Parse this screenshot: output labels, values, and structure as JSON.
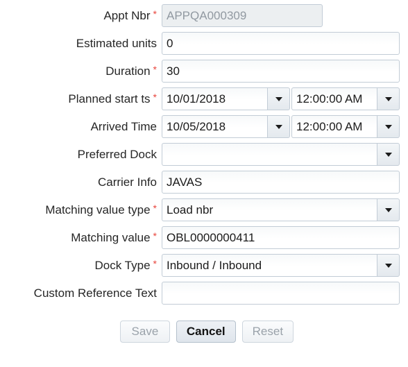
{
  "form": {
    "required_marker": "*",
    "accent_required_color": "#e8453c",
    "rows": [
      {
        "label": "Appt Nbr",
        "required": true,
        "value": "APPQA000309"
      },
      {
        "label": "Estimated units",
        "required": false,
        "value": "0"
      },
      {
        "label": "Duration",
        "required": true,
        "value": "30"
      },
      {
        "label": "Planned start ts",
        "required": true,
        "date": "10/01/2018",
        "time": "12:00:00 AM"
      },
      {
        "label": "Arrived Time",
        "required": false,
        "date": "10/05/2018",
        "time": "12:00:00 AM"
      },
      {
        "label": "Preferred Dock",
        "required": false,
        "value": ""
      },
      {
        "label": "Carrier Info",
        "required": false,
        "value": "JAVAS"
      },
      {
        "label": "Matching value type",
        "required": true,
        "value": "Load nbr"
      },
      {
        "label": "Matching value",
        "required": true,
        "value": "OBL0000000411"
      },
      {
        "label": "Dock Type",
        "required": true,
        "value": "Inbound / Inbound"
      },
      {
        "label": "Custom Reference Text",
        "required": false,
        "value": ""
      }
    ]
  },
  "buttons": {
    "save": "Save",
    "cancel": "Cancel",
    "reset": "Reset"
  },
  "icons": {
    "dropdown": "chevron-down-icon"
  }
}
